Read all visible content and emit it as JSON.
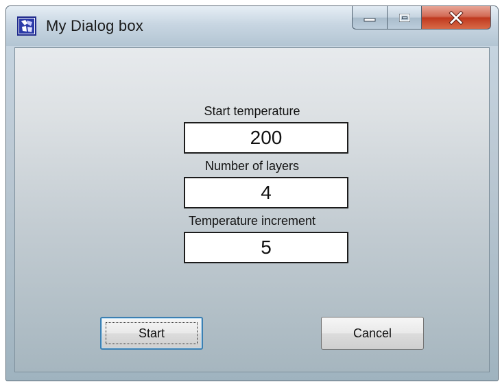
{
  "window": {
    "title": "My Dialog box",
    "icon": "app-icon",
    "caption_buttons": {
      "minimize_icon": "minimize-icon",
      "maximize_icon": "maximize-icon",
      "close_icon": "close-icon",
      "close_glyph": "X"
    }
  },
  "fields": [
    {
      "label": "Start temperature",
      "value": "200"
    },
    {
      "label": "Number of layers",
      "value": "4"
    },
    {
      "label": "Temperature increment",
      "value": "5"
    }
  ],
  "buttons": {
    "start_label": "Start",
    "cancel_label": "Cancel"
  },
  "colors": {
    "close_button": "#c0391f",
    "focus_border": "#3c7fb1"
  }
}
